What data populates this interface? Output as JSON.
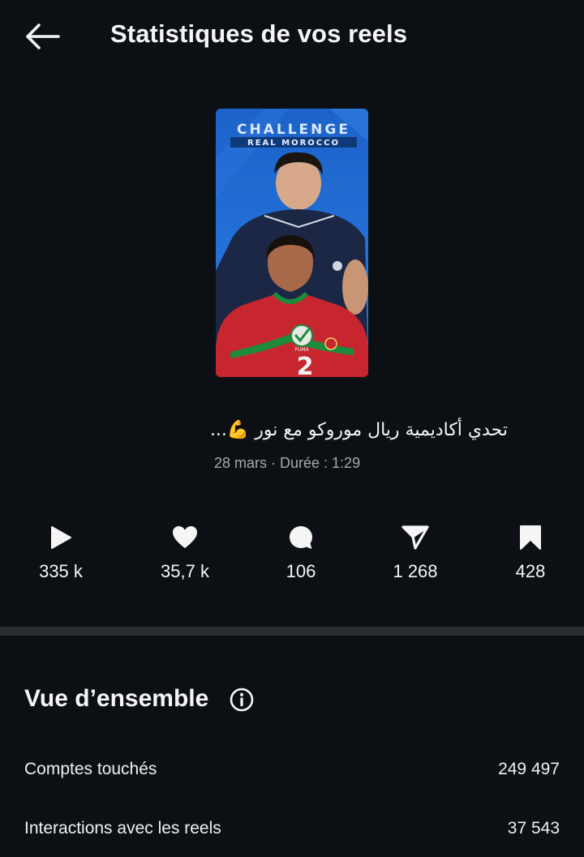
{
  "header": {
    "back_icon": "arrow-left-icon",
    "title": "Statistiques de vos reels"
  },
  "reel": {
    "thumbnail": {
      "challenge_text": "CHALLENGE",
      "subtitle_text": "REAL MOROCCO",
      "jersey_number": "2",
      "brand_text": "PUMA"
    },
    "caption": "تحدي أكاديمية ريال موروكو مع نور 💪...",
    "meta": "28 mars · Durée : 1:29"
  },
  "stats": [
    {
      "icon": "play-icon",
      "value": "335 k"
    },
    {
      "icon": "heart-icon",
      "value": "35,7 k"
    },
    {
      "icon": "comment-icon",
      "value": "106"
    },
    {
      "icon": "share-icon",
      "value": "1 268"
    },
    {
      "icon": "bookmark-icon",
      "value": "428"
    }
  ],
  "overview": {
    "title": "Vue d’ensemble",
    "info_icon": "info-icon",
    "rows": [
      {
        "label": "Comptes touchés",
        "value": "249 497"
      },
      {
        "label": "Interactions avec les reels",
        "value": "37 543"
      }
    ]
  },
  "colors": {
    "background": "#0c1014",
    "text_primary": "#f5f5f5",
    "text_secondary": "#a8a8a8",
    "divider": "#2a2d31"
  }
}
